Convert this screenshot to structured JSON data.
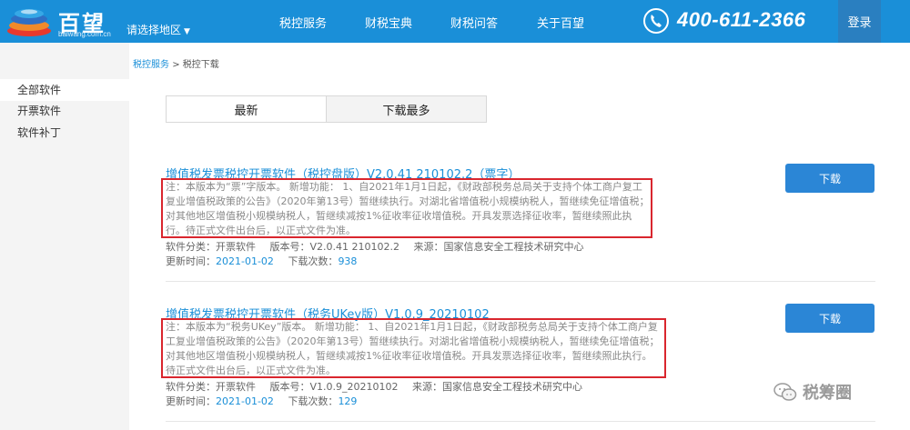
{
  "header": {
    "logo_text": "百望",
    "logo_domain": "baiwang.com.cn",
    "region_label": "请选择地区",
    "nav": [
      "税控服务",
      "财税宝典",
      "财税问答",
      "关于百望"
    ],
    "phone": "400-611-2366",
    "login_label": "登录"
  },
  "sidebar": {
    "items": [
      {
        "label": "全部软件"
      },
      {
        "label": "开票软件"
      },
      {
        "label": "软件补丁"
      }
    ]
  },
  "breadcrumb": {
    "root": "税控服务",
    "sep": ">",
    "current": "税控下载"
  },
  "tabs": [
    {
      "label": "最新"
    },
    {
      "label": "下载最多"
    }
  ],
  "software": [
    {
      "title": "增值税发票税控开票软件（税控盘版）V2.0.41 210102.2（票字）",
      "desc": "注：本版本为“票”字版本。 新增功能： 1、自2021年1月1日起，《财政部税务总局关于支持个体工商户复工复业增值税政策的公告》（2020年第13号）暂继续执行。对湖北省增值税小规模纳税人，暂继续免征增值税；对其他地区增值税小规模纳税人，暂继续减按1%征收率征收增值税。开具发票选择征收率，暂继续照此执行。待正式文件出台后，以正式文件为准。",
      "category_label": "软件分类：",
      "category": "开票软件",
      "version_label": "版本号：",
      "version": "V2.0.41 210102.2",
      "source_label": "来源：",
      "source": "国家信息安全工程技术研究中心",
      "updated_label": "更新时间：",
      "updated": "2021-01-02",
      "downloads_label": "下载次数：",
      "downloads": "938",
      "download_label": "下载"
    },
    {
      "title": "增值税发票税控开票软件（税务UKey版）V1.0.9_20210102",
      "desc": "注：本版本为“税务UKey”版本。 新增功能： 1、自2021年1月1日起，《财政部税务总局关于支持个体工商户复工复业增值税政策的公告》（2020年第13号）暂继续执行。对湖北省增值税小规模纳税人，暂继续免征增值税；对其他地区增值税小规模纳税人，暂继续减按1%征收率征收增值税。开具发票选择征收率，暂继续照此执行。待正式文件出台后，以正式文件为准。",
      "category_label": "软件分类：",
      "category": "开票软件",
      "version_label": "版本号：",
      "version": "V1.0.9_20210102",
      "source_label": "来源：",
      "source": "国家信息安全工程技术研究中心",
      "updated_label": "更新时间：",
      "updated": "2021-01-02",
      "downloads_label": "下载次数：",
      "downloads": "129",
      "download_label": "下载"
    }
  ],
  "watermark": "税筹圈",
  "colors": {
    "brand_blue": "#1a8fd8",
    "button_blue": "#2b86d6",
    "highlight_red": "#d9262e"
  }
}
